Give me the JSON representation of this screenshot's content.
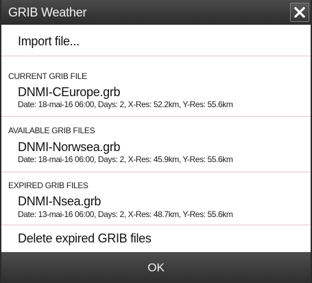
{
  "dialog": {
    "title": "GRIB Weather",
    "close_icon": "close-icon"
  },
  "actions": {
    "import_label": "Import file...",
    "delete_expired_label": "Delete expired GRIB files"
  },
  "current": {
    "header": "CURRENT GRIB FILE",
    "files": [
      {
        "name": "DNMI-CEurope.grb",
        "details": "Date: 18-mai-16 06:00, Days: 2, X-Res: 52.2km, Y-Res: 55.6km"
      }
    ]
  },
  "available": {
    "header": "AVAILABLE GRIB FILES",
    "files": [
      {
        "name": "DNMI-Norwsea.grb",
        "details": "Date: 18-mai-16 06:00, Days: 2, X-Res: 45.9km, Y-Res: 55.6km"
      }
    ]
  },
  "expired": {
    "header": "EXPIRED GRIB FILES",
    "files": [
      {
        "name": "DNMI-Nsea.grb",
        "details": "Date: 13-mai-16 06:00, Days: 2, X-Res: 48.7km, Y-Res: 55.6km"
      }
    ]
  },
  "footer": {
    "ok_label": "OK"
  },
  "colors": {
    "titlebar": "#3a3a3a",
    "divider": "#e4c4c8",
    "footer": "#3e3e3e"
  }
}
